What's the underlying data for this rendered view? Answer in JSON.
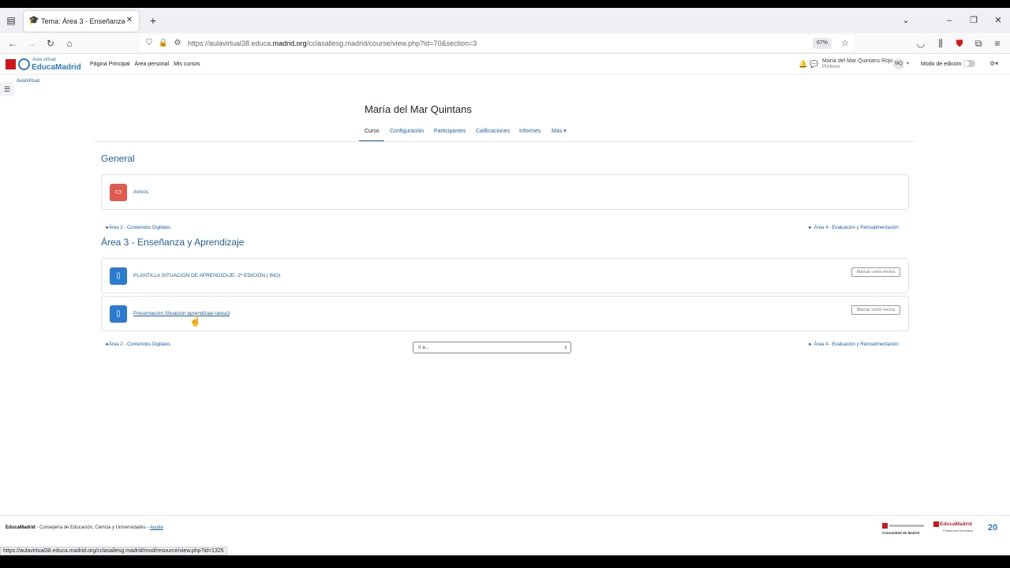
{
  "browser": {
    "tab_title": "Tema: Área 3 - Enseñanza y Aprendizaje",
    "url_prefix": "https://aulavirtual38.educa.",
    "url_domain": "madrid.org",
    "url_path": "/cclasallesg.madrid/course/view.php?id=70&section=3",
    "zoom": "67%",
    "status_url": "https://aulavirtual38.educa.madrid.org/cclasallesg.madrid/mod/resource/view.php?id=1325"
  },
  "site": {
    "logo_small": "Aula virtual",
    "logo_big": "EducaMadrid",
    "nav": [
      "Página Principal",
      "Área personal",
      "Mis cursos"
    ],
    "user_name": "María del Mar Quintans Rojo",
    "user_role": "Profesor",
    "avatar_initials": "MQ",
    "edit_mode_label": "Modo de edición"
  },
  "breadcrumb": "AulaVirtual",
  "course": {
    "title": "María del Mar Quintans",
    "tabs": [
      "Curso",
      "Configuración",
      "Participantes",
      "Calificaciones",
      "Informes",
      "Más ▾"
    ]
  },
  "general": {
    "heading": "General",
    "activity": "Avisos"
  },
  "nav_links": {
    "prev": "◄Área 2 - Contenidos Digitales",
    "next": "► Área 4 - Evaluación y Retroalimentación"
  },
  "section": {
    "heading": "Área 3 - Enseñanza y Aprendizaje",
    "activities": [
      {
        "name": "PLANTILLA SITUACIÓN DE APRENDIZAJE- 2ª EDICIÓN ( BIO)",
        "button": "Marcar como hecha"
      },
      {
        "name": "Presentación Situación aprendizaje tarea3",
        "button": "Marcar como hecha"
      }
    ]
  },
  "jump_select": "Ir a...",
  "footer": {
    "brand": "EducaMadrid",
    "text": " - Consejería de Educación, Ciencia y Universidades - ",
    "help": "Ayuda",
    "logo1": "Comunidad de Madrid",
    "logo2": "EducaMadrid",
    "logo2_sub": "Plataforma Educativa",
    "logo3": "20"
  }
}
